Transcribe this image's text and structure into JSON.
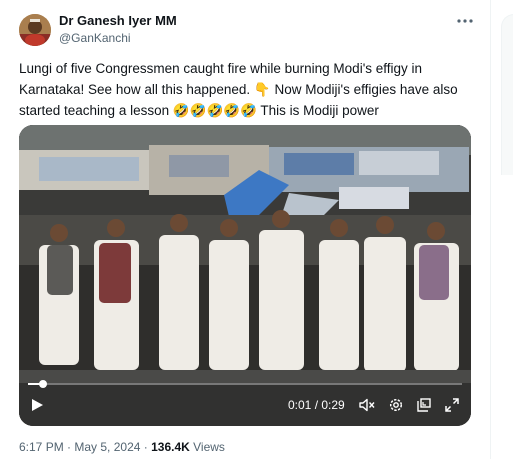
{
  "author": {
    "display_name": "Dr Ganesh Iyer MM",
    "handle": "@GanKanchi"
  },
  "tweet": {
    "lines": [
      "Lungi of five Congressmen caught fire while burning Modi's effigy in",
      "Karnataka! See how all this happened. 👇 Now Modiji's effigies have also",
      "started teaching a lesson 🤣🤣🤣🤣🤣 This is Modiji power"
    ]
  },
  "video": {
    "current_time": "0:01",
    "separator": " / ",
    "duration": "0:29",
    "progress_fraction": 0.034,
    "icons": [
      "play-icon",
      "volume-muted-icon",
      "settings-gear-icon",
      "pip-icon",
      "fullscreen-icon"
    ]
  },
  "meta": {
    "time": "6:17 PM",
    "dot": " · ",
    "date": "May 5, 2024",
    "views_count": "136.4K",
    "views_label": " Views"
  },
  "colors": {
    "text_primary": "#0f1419",
    "text_secondary": "#536471",
    "divider": "#eff3f4"
  }
}
